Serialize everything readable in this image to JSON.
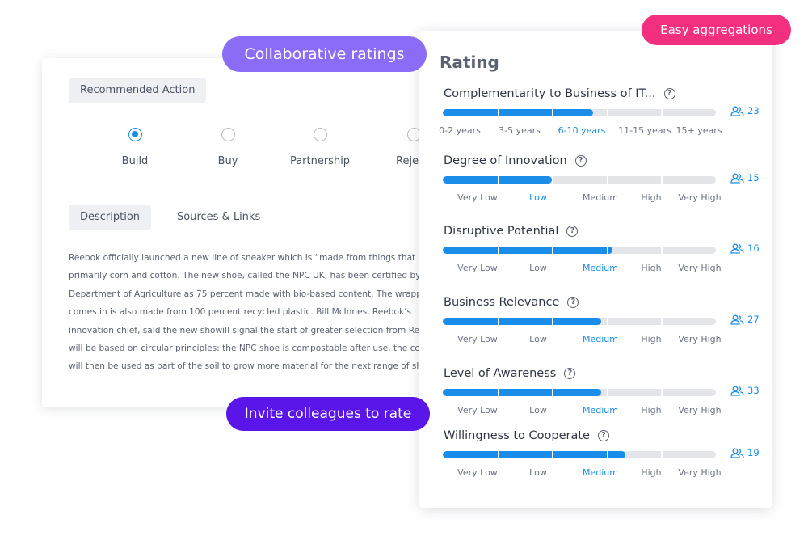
{
  "pills": {
    "collaborative": "Collaborative ratings",
    "invite": "Invite colleagues to rate",
    "easy": "Easy aggregations"
  },
  "left": {
    "recommended_label": "Recommended Action",
    "options": [
      {
        "label": "Build",
        "selected": true
      },
      {
        "label": "Buy",
        "selected": false
      },
      {
        "label": "Partnership",
        "selected": false
      },
      {
        "label": "Rejecti",
        "selected": false
      }
    ],
    "tabs": [
      {
        "label": "Description",
        "active": true
      },
      {
        "label": "Sources & Links",
        "active": false
      }
    ],
    "description_lines": [
      "Reebok officially launched a new line of sneaker which is “made from things that gr",
      "primarily corn and cotton. The new shoe, called the NPC UK, has been certified by t",
      "Department of Agriculture as 75 percent made with bio-based content. The wrappin",
      "comes in is also made from 100 percent recycled plastic. Bill McInnes, Reebok’s",
      "innovation chief, said the new showill signal the start of greater selection from Re",
      "will be based on circular principles: the NPC shoe is compostable after use, the com",
      "will then be used as part of the soil to grow more material for the next range of sho"
    ]
  },
  "rating": {
    "title": "Rating",
    "criteria": [
      {
        "name": "Complementarity to Business of IT...",
        "count": "23",
        "level": 0.55,
        "scale": [
          "0-2 years",
          "3-5 years",
          "6-10 years",
          "11-15 years",
          "15+ years"
        ],
        "selected": 2
      },
      {
        "name": "Degree of Innovation",
        "count": "15",
        "level": 0.4,
        "scale": [
          "Very Low",
          "Low",
          "Medium",
          "High",
          "Very High"
        ],
        "selected": 1
      },
      {
        "name": "Disruptive Potential",
        "count": "16",
        "level": 0.62,
        "scale": [
          "Very Low",
          "Low",
          "Medium",
          "High",
          "Very High"
        ],
        "selected": 2
      },
      {
        "name": "Business Relevance",
        "count": "27",
        "level": 0.58,
        "scale": [
          "Very Low",
          "Low",
          "Medium",
          "High",
          "Very High"
        ],
        "selected": 2
      },
      {
        "name": "Level of Awareness",
        "count": "33",
        "level": 0.58,
        "scale": [
          "Very Low",
          "Low",
          "Medium",
          "High",
          "Very High"
        ],
        "selected": 2
      },
      {
        "name": "Willingness to Cooperate",
        "count": "19",
        "level": 0.67,
        "scale": [
          "Very Low",
          "Low",
          "Medium",
          "High",
          "Very High"
        ],
        "selected": 2
      }
    ]
  },
  "colors": {
    "accent_blue": "#1a8de8",
    "collab_pill": "#8a6cf7",
    "invite_pill": "#5a16e8",
    "easy_pill": "#f2307f"
  },
  "icons": {
    "help": "question-circle-icon",
    "count": "users-icon"
  }
}
